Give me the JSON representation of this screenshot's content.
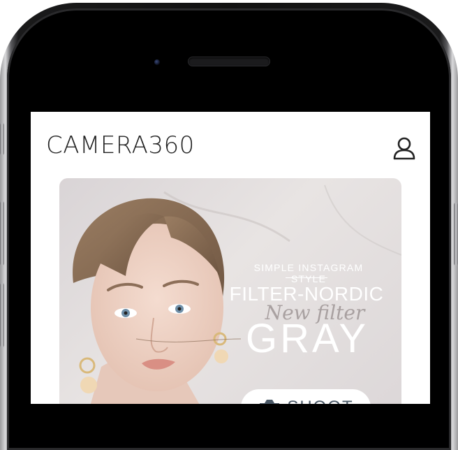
{
  "app": {
    "title": "CAMERA360"
  },
  "header": {
    "profile_icon": "user-profile-icon"
  },
  "banner": {
    "subtitle": "SIMPLE INSTAGRAM STYLE",
    "title": "FILTER-NORDIC",
    "script_text": "New filter",
    "big_text": "GRAY",
    "button_label": "SHOOT",
    "button_icon": "camera-icon"
  },
  "colors": {
    "screen_bg": "#ffffff",
    "title_text": "#222222",
    "banner_text": "#ffffff",
    "button_text": "#4a5866",
    "phone_frame": "#111111"
  }
}
